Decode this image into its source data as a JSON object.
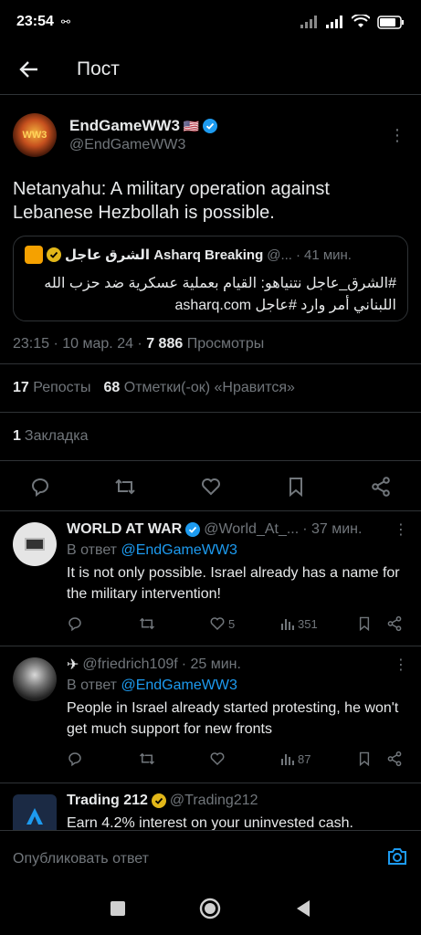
{
  "status_bar": {
    "time": "23:54"
  },
  "header": {
    "title": "Пост"
  },
  "main_tweet": {
    "author_name": "EndGameWW3",
    "author_flag": "🇺🇸",
    "author_handle": "@EndGameWW3",
    "text": "Netanyahu: A military operation against Lebanese Hezbollah is possible.",
    "quote": {
      "name": "الشرق عاجل Asharq Breaking",
      "handle": "@...",
      "time": "41 мин.",
      "text": "#الشرق_عاجل نتنياهو: القيام بعملية عسكرية ضد حزب الله اللبناني أمر وارد #عاجل asharq.com"
    },
    "meta_datetime": "23:15 · 10 мар. 24 · ",
    "views_count": "7 886",
    "views_label": " Просмотры",
    "reposts_count": "17",
    "reposts_label": "Репосты",
    "likes_count": "68",
    "likes_label": "Отметки(-ок) «Нравится»",
    "bookmarks_count": "1",
    "bookmarks_label": "Закладка"
  },
  "replies": [
    {
      "name": "WORLD AT WAR",
      "handle": "@World_At_...",
      "time": "· 37 мин.",
      "reply_to_prefix": "В ответ ",
      "reply_to": "@EndGameWW3",
      "text": "It is not only possible. Israel already has a name for the military intervention!",
      "likes": "5",
      "views": "351"
    },
    {
      "name": "✈",
      "handle": "@friedrich109f",
      "time": "· 25 мин.",
      "reply_to_prefix": "В ответ ",
      "reply_to": "@EndGameWW3",
      "text": "People in Israel already started protesting, he won't get much support for new fronts",
      "likes": "",
      "views": "87"
    },
    {
      "name": "Trading 212",
      "handle": "@Trading212",
      "text": "Earn 4.2% interest on your uninvested cash."
    }
  ],
  "composer": {
    "placeholder": "Опубликовать ответ"
  },
  "colors": {
    "accent": "#1d9bf0",
    "muted": "#71767b",
    "text": "#e7e9ea",
    "background": "#000000"
  }
}
